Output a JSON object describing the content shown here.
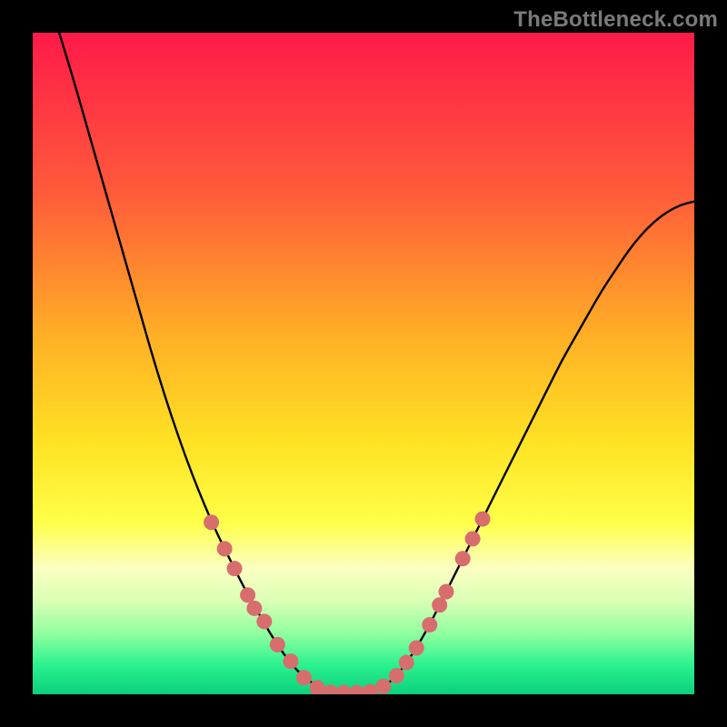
{
  "watermark": "TheBottleneck.com",
  "chart_data": {
    "type": "line",
    "title": "",
    "xlabel": "",
    "ylabel": "",
    "xlim": [
      0,
      100
    ],
    "ylim": [
      0,
      100
    ],
    "gradient_stops": [
      {
        "offset": 0.0,
        "color": "#ff1a49"
      },
      {
        "offset": 0.24,
        "color": "#ff5a3a"
      },
      {
        "offset": 0.46,
        "color": "#ffb025"
      },
      {
        "offset": 0.62,
        "color": "#ffe224"
      },
      {
        "offset": 0.74,
        "color": "#ffff48"
      },
      {
        "offset": 0.81,
        "color": "#fbffc2"
      },
      {
        "offset": 0.86,
        "color": "#d8ffb4"
      },
      {
        "offset": 0.91,
        "color": "#8dff9f"
      },
      {
        "offset": 0.955,
        "color": "#2cf28f"
      },
      {
        "offset": 1.0,
        "color": "#0bd07d"
      }
    ],
    "series": [
      {
        "name": "curve",
        "points": [
          {
            "x": 4.0,
            "y": 100.0
          },
          {
            "x": 6.0,
            "y": 93.5
          },
          {
            "x": 8.0,
            "y": 86.5
          },
          {
            "x": 10.0,
            "y": 79.5
          },
          {
            "x": 12.0,
            "y": 72.5
          },
          {
            "x": 14.0,
            "y": 65.5
          },
          {
            "x": 16.0,
            "y": 58.5
          },
          {
            "x": 18.0,
            "y": 51.5
          },
          {
            "x": 20.0,
            "y": 45.0
          },
          {
            "x": 22.0,
            "y": 39.0
          },
          {
            "x": 24.0,
            "y": 33.5
          },
          {
            "x": 26.0,
            "y": 28.5
          },
          {
            "x": 28.0,
            "y": 24.0
          },
          {
            "x": 30.0,
            "y": 20.0
          },
          {
            "x": 32.0,
            "y": 16.0
          },
          {
            "x": 34.0,
            "y": 12.5
          },
          {
            "x": 36.0,
            "y": 9.0
          },
          {
            "x": 38.0,
            "y": 6.0
          },
          {
            "x": 40.0,
            "y": 3.5
          },
          {
            "x": 42.0,
            "y": 1.8
          },
          {
            "x": 44.0,
            "y": 0.8
          },
          {
            "x": 46.0,
            "y": 0.2
          },
          {
            "x": 48.0,
            "y": 0.2
          },
          {
            "x": 50.0,
            "y": 0.2
          },
          {
            "x": 52.0,
            "y": 0.6
          },
          {
            "x": 54.0,
            "y": 1.8
          },
          {
            "x": 56.0,
            "y": 4.0
          },
          {
            "x": 58.0,
            "y": 7.0
          },
          {
            "x": 60.0,
            "y": 10.5
          },
          {
            "x": 62.0,
            "y": 14.5
          },
          {
            "x": 64.0,
            "y": 18.5
          },
          {
            "x": 66.0,
            "y": 22.5
          },
          {
            "x": 68.0,
            "y": 26.5
          },
          {
            "x": 70.0,
            "y": 30.5
          },
          {
            "x": 72.0,
            "y": 34.5
          },
          {
            "x": 74.0,
            "y": 38.5
          },
          {
            "x": 76.0,
            "y": 42.5
          },
          {
            "x": 78.0,
            "y": 46.5
          },
          {
            "x": 80.0,
            "y": 50.5
          },
          {
            "x": 82.0,
            "y": 54.0
          },
          {
            "x": 84.0,
            "y": 57.5
          },
          {
            "x": 86.0,
            "y": 61.0
          },
          {
            "x": 88.0,
            "y": 64.0
          },
          {
            "x": 90.0,
            "y": 67.0
          },
          {
            "x": 92.0,
            "y": 69.5
          },
          {
            "x": 94.0,
            "y": 71.5
          },
          {
            "x": 96.0,
            "y": 73.0
          },
          {
            "x": 98.0,
            "y": 74.0
          },
          {
            "x": 100.0,
            "y": 74.5
          }
        ]
      }
    ],
    "markers": [
      {
        "x": 27.0,
        "y": 26.0
      },
      {
        "x": 29.0,
        "y": 22.0
      },
      {
        "x": 30.5,
        "y": 19.0
      },
      {
        "x": 32.5,
        "y": 15.0
      },
      {
        "x": 33.5,
        "y": 13.0
      },
      {
        "x": 35.0,
        "y": 11.0
      },
      {
        "x": 37.0,
        "y": 7.5
      },
      {
        "x": 39.0,
        "y": 5.0
      },
      {
        "x": 41.0,
        "y": 2.5
      },
      {
        "x": 43.0,
        "y": 1.0
      },
      {
        "x": 45.0,
        "y": 0.3
      },
      {
        "x": 47.0,
        "y": 0.25
      },
      {
        "x": 49.0,
        "y": 0.25
      },
      {
        "x": 51.0,
        "y": 0.4
      },
      {
        "x": 53.0,
        "y": 1.2
      },
      {
        "x": 55.0,
        "y": 2.8
      },
      {
        "x": 56.5,
        "y": 4.8
      },
      {
        "x": 58.0,
        "y": 7.0
      },
      {
        "x": 60.0,
        "y": 10.5
      },
      {
        "x": 61.5,
        "y": 13.5
      },
      {
        "x": 62.5,
        "y": 15.5
      },
      {
        "x": 65.0,
        "y": 20.5
      },
      {
        "x": 66.5,
        "y": 23.5
      },
      {
        "x": 68.0,
        "y": 26.5
      }
    ],
    "marker_color": "#d86d6d",
    "curve_color": "#000000"
  }
}
